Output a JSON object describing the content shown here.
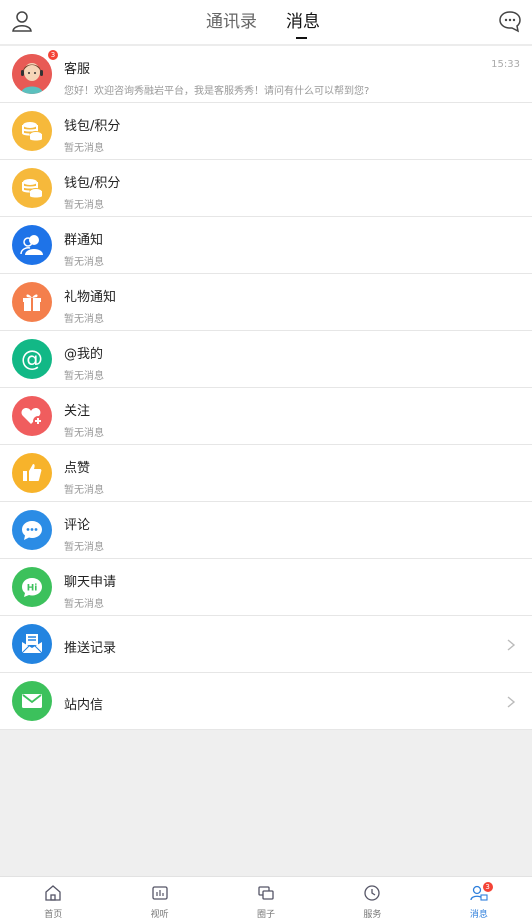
{
  "header": {
    "tab_contacts": "通讯录",
    "tab_messages": "消息"
  },
  "messages": [
    {
      "title": "客服",
      "subtitle": "您好！欢迎咨询秀融岩平台，我是客服秀秀！请问有什么可以帮到您?",
      "time": "15:33",
      "badge": "3",
      "icon": "customer-service-avatar",
      "color": "#e85a55"
    },
    {
      "title": "钱包/积分",
      "subtitle": "暂无消息",
      "icon": "coins-icon",
      "color": "#f6b93b"
    },
    {
      "title": "钱包/积分",
      "subtitle": "暂无消息",
      "icon": "coins-icon",
      "color": "#f6b93b"
    },
    {
      "title": "群通知",
      "subtitle": "暂无消息",
      "icon": "group-icon",
      "color": "#1e73e8"
    },
    {
      "title": "礼物通知",
      "subtitle": "暂无消息",
      "icon": "gift-icon",
      "color": "#f47f4c"
    },
    {
      "title": "@我的",
      "subtitle": "暂无消息",
      "icon": "at-icon",
      "color": "#12b886"
    },
    {
      "title": "关注",
      "subtitle": "暂无消息",
      "icon": "heart-plus-icon",
      "color": "#f05d5e"
    },
    {
      "title": "点赞",
      "subtitle": "暂无消息",
      "icon": "thumbs-up-icon",
      "color": "#f7b32b"
    },
    {
      "title": "评论",
      "subtitle": "暂无消息",
      "icon": "comment-icon",
      "color": "#2b8ce5"
    },
    {
      "title": "聊天申请",
      "subtitle": "暂无消息",
      "icon": "hi-chat-icon",
      "color": "#3cc15c"
    }
  ],
  "links": [
    {
      "title": "推送记录",
      "icon": "push-record-icon",
      "color": "#2384e0"
    },
    {
      "title": "站内信",
      "icon": "mail-icon",
      "color": "#3cc15c"
    }
  ],
  "tabbar": {
    "home": "首页",
    "video": "视听",
    "circle": "圈子",
    "service": "服务",
    "messages": "消息",
    "messages_badge": "3",
    "active_color": "#2e7fdc"
  }
}
